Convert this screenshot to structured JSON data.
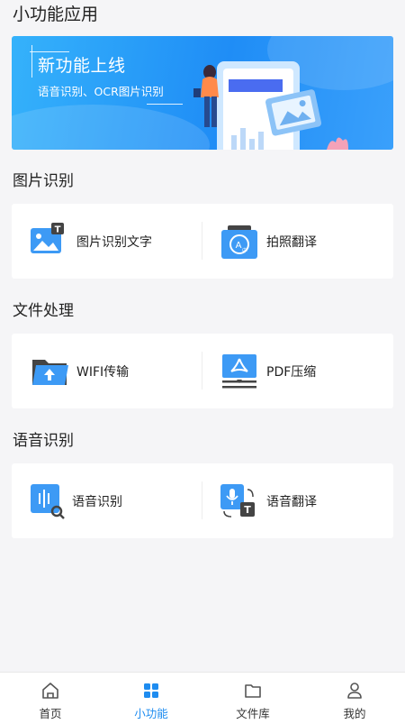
{
  "page": {
    "title": "小功能应用"
  },
  "banner": {
    "title": "新功能上线",
    "subtitle": "语音识别、OCR图片识别"
  },
  "sections": [
    {
      "title": "图片识别",
      "items": [
        {
          "label": "图片识别文字",
          "icon": "image-text-icon"
        },
        {
          "label": "拍照翻译",
          "icon": "photo-translate-icon"
        }
      ]
    },
    {
      "title": "文件处理",
      "items": [
        {
          "label": "WIFI传输",
          "icon": "wifi-transfer-icon"
        },
        {
          "label": "PDF压缩",
          "icon": "pdf-compress-icon"
        }
      ]
    },
    {
      "title": "语音识别",
      "items": [
        {
          "label": "语音识别",
          "icon": "voice-recognition-icon"
        },
        {
          "label": "语音翻译",
          "icon": "voice-translate-icon"
        }
      ]
    }
  ],
  "tabbar": {
    "items": [
      {
        "label": "首页",
        "icon": "home-icon"
      },
      {
        "label": "小功能",
        "icon": "grid-icon",
        "active": true
      },
      {
        "label": "文件库",
        "icon": "folder-icon"
      },
      {
        "label": "我的",
        "icon": "user-icon"
      }
    ]
  },
  "colors": {
    "accent": "#1e8cf0",
    "icon_blue": "#3d9af5",
    "icon_dark": "#444444"
  }
}
